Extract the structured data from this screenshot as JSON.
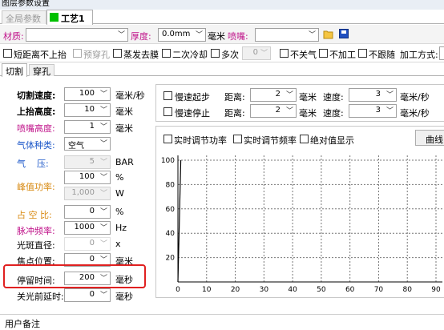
{
  "window_title": "图层参数设置",
  "top_tabs": [
    {
      "label": "全局参数"
    },
    {
      "label": "工艺1"
    }
  ],
  "accent": "#00c000",
  "highlight_color": "#e02020",
  "material_bar": {
    "material_label": "材质:",
    "thickness_label": "厚度:",
    "thickness_value": "0.0mm",
    "unit": "毫米",
    "nozzle_label": "喷嘴:"
  },
  "options_bar": {
    "short_dist_label": "短距离不上抬",
    "pre_pierce_label": "预穿孔",
    "evaporate_label": "蒸发去膜",
    "secondary_cool_label": "二次冷却",
    "multi_label": "多次",
    "multi_value": "0",
    "no_close_gas_label": "不关气",
    "no_process_label": "不加工",
    "no_follow_label": "不跟随",
    "process_mode_label": "加工方式:"
  },
  "sub_tabs": [
    {
      "label": "切割"
    },
    {
      "label": "穿孔"
    }
  ],
  "params": [
    {
      "label": "切割速度:",
      "value": "100",
      "unit": "毫米/秒"
    },
    {
      "label": "上抬高度:",
      "value": "10",
      "unit": "毫米"
    },
    {
      "label": "喷嘴高度:",
      "value": "1",
      "unit": "毫米"
    },
    {
      "label": "气体种类:",
      "value": "空气",
      "unit": ""
    },
    {
      "label": "气    压:",
      "value": "5",
      "unit": "BAR"
    },
    {
      "label": "",
      "value": "100",
      "unit": "%"
    },
    {
      "label": "峰值功率:",
      "value": "1,000",
      "unit": "W"
    },
    {
      "label": "占 空 比:",
      "value": "0",
      "unit": "%"
    },
    {
      "label": "脉冲频率:",
      "value": "1000",
      "unit": "Hz"
    },
    {
      "label": "光斑直径:",
      "value": "0",
      "unit": "x"
    },
    {
      "label": "焦点位置:",
      "value": "0",
      "unit": "毫米"
    },
    {
      "label": "停留时间:",
      "value": "200",
      "unit": "毫秒"
    },
    {
      "label": "关光前延时:",
      "value": "0",
      "unit": "毫秒"
    }
  ],
  "speed_ctrl": {
    "slow_start_label": "慢速起步",
    "slow_stop_label": "慢速停止",
    "distance_label": "距离:",
    "distance1": "2",
    "distance2": "2",
    "dist_unit": "毫米",
    "speed_label": "速度:",
    "speed1": "3",
    "speed2": "3",
    "speed_unit": "毫米/秒"
  },
  "chart_opts": {
    "realtime_power_label": "实时调节功率",
    "realtime_freq_label": "实时调节频率",
    "absolute_label": "绝对值显示",
    "curve_button": "曲线"
  },
  "chart_data": {
    "type": "line",
    "x_ticks": [
      "0",
      "10",
      "20",
      "30",
      "40",
      "50",
      "60",
      "70",
      "80",
      "90"
    ],
    "y_ticks": [
      "100",
      "80",
      "60",
      "40",
      "20"
    ],
    "xlim": [
      0,
      90
    ],
    "ylim": [
      0,
      100
    ],
    "grid": true,
    "series": [
      {
        "x": [
          0,
          1
        ],
        "y": [
          0,
          100
        ]
      }
    ]
  },
  "user_note_label": "用户备注"
}
